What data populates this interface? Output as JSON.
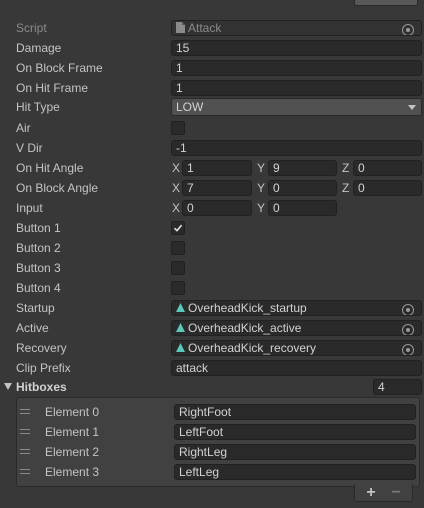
{
  "fields": {
    "script": {
      "label": "Script",
      "value": "Attack"
    },
    "damage": {
      "label": "Damage",
      "value": "15"
    },
    "on_block_frame": {
      "label": "On Block Frame",
      "value": "1"
    },
    "on_hit_frame": {
      "label": "On Hit Frame",
      "value": "1"
    },
    "hit_type": {
      "label": "Hit Type",
      "value": "LOW"
    },
    "air": {
      "label": "Air",
      "checked": false
    },
    "v_dir": {
      "label": "V Dir",
      "value": "-1"
    },
    "on_hit_angle": {
      "label": "On Hit Angle",
      "x_label": "X",
      "x": "1",
      "y_label": "Y",
      "y": "9",
      "z_label": "Z",
      "z": "0"
    },
    "on_block_angle": {
      "label": "On Block Angle",
      "x_label": "X",
      "x": "7",
      "y_label": "Y",
      "y": "0",
      "z_label": "Z",
      "z": "0"
    },
    "input": {
      "label": "Input",
      "x_label": "X",
      "x": "0",
      "y_label": "Y",
      "y": "0"
    },
    "button1": {
      "label": "Button 1",
      "checked": true
    },
    "button2": {
      "label": "Button 2",
      "checked": false
    },
    "button3": {
      "label": "Button 3",
      "checked": false
    },
    "button4": {
      "label": "Button 4",
      "checked": false
    },
    "startup": {
      "label": "Startup",
      "value": "OverheadKick_startup"
    },
    "active": {
      "label": "Active",
      "value": "OverheadKick_active"
    },
    "recovery": {
      "label": "Recovery",
      "value": "OverheadKick_recovery"
    },
    "clip_prefix": {
      "label": "Clip Prefix",
      "value": "attack"
    }
  },
  "hitboxes": {
    "label": "Hitboxes",
    "size": "4",
    "elements": [
      {
        "label": "Element 0",
        "value": "RightFoot"
      },
      {
        "label": "Element 1",
        "value": "LeftFoot"
      },
      {
        "label": "Element 2",
        "value": "RightLeg"
      },
      {
        "label": "Element 3",
        "value": "LeftLeg"
      }
    ],
    "add_label": "+",
    "remove_label": "−"
  },
  "icons": {
    "script": "csharp-script-icon",
    "animation": "animation-clip-icon",
    "picker": "object-picker-icon",
    "dropdown": "chevron-down-icon",
    "checkmark": "checkmark-icon",
    "foldout": "foldout-triangle-icon",
    "drag": "drag-handle-icon"
  },
  "colors": {
    "background": "#383838",
    "field": "#2a2a2a",
    "text": "#c4c4c4",
    "animation_icon": "#5cc8b8"
  }
}
